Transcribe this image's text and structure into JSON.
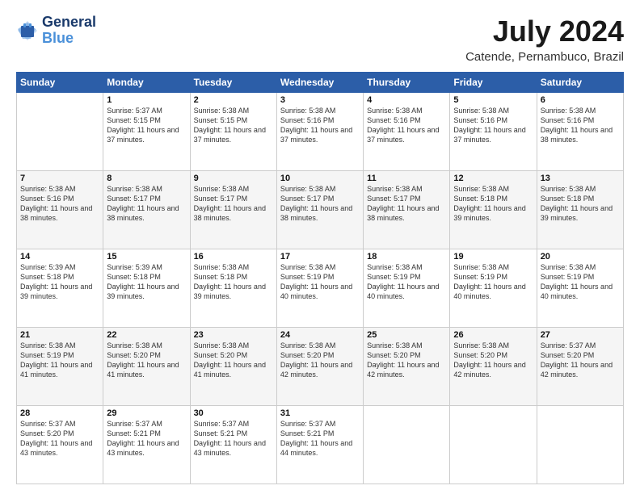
{
  "header": {
    "logo_line1": "General",
    "logo_line2": "Blue",
    "main_title": "July 2024",
    "subtitle": "Catende, Pernambuco, Brazil"
  },
  "calendar": {
    "days_of_week": [
      "Sunday",
      "Monday",
      "Tuesday",
      "Wednesday",
      "Thursday",
      "Friday",
      "Saturday"
    ],
    "weeks": [
      [
        {
          "day": "",
          "sunrise": "",
          "sunset": "",
          "daylight": ""
        },
        {
          "day": "1",
          "sunrise": "Sunrise: 5:37 AM",
          "sunset": "Sunset: 5:15 PM",
          "daylight": "Daylight: 11 hours and 37 minutes."
        },
        {
          "day": "2",
          "sunrise": "Sunrise: 5:38 AM",
          "sunset": "Sunset: 5:15 PM",
          "daylight": "Daylight: 11 hours and 37 minutes."
        },
        {
          "day": "3",
          "sunrise": "Sunrise: 5:38 AM",
          "sunset": "Sunset: 5:16 PM",
          "daylight": "Daylight: 11 hours and 37 minutes."
        },
        {
          "day": "4",
          "sunrise": "Sunrise: 5:38 AM",
          "sunset": "Sunset: 5:16 PM",
          "daylight": "Daylight: 11 hours and 37 minutes."
        },
        {
          "day": "5",
          "sunrise": "Sunrise: 5:38 AM",
          "sunset": "Sunset: 5:16 PM",
          "daylight": "Daylight: 11 hours and 37 minutes."
        },
        {
          "day": "6",
          "sunrise": "Sunrise: 5:38 AM",
          "sunset": "Sunset: 5:16 PM",
          "daylight": "Daylight: 11 hours and 38 minutes."
        }
      ],
      [
        {
          "day": "7",
          "sunrise": "Sunrise: 5:38 AM",
          "sunset": "Sunset: 5:16 PM",
          "daylight": "Daylight: 11 hours and 38 minutes."
        },
        {
          "day": "8",
          "sunrise": "Sunrise: 5:38 AM",
          "sunset": "Sunset: 5:17 PM",
          "daylight": "Daylight: 11 hours and 38 minutes."
        },
        {
          "day": "9",
          "sunrise": "Sunrise: 5:38 AM",
          "sunset": "Sunset: 5:17 PM",
          "daylight": "Daylight: 11 hours and 38 minutes."
        },
        {
          "day": "10",
          "sunrise": "Sunrise: 5:38 AM",
          "sunset": "Sunset: 5:17 PM",
          "daylight": "Daylight: 11 hours and 38 minutes."
        },
        {
          "day": "11",
          "sunrise": "Sunrise: 5:38 AM",
          "sunset": "Sunset: 5:17 PM",
          "daylight": "Daylight: 11 hours and 38 minutes."
        },
        {
          "day": "12",
          "sunrise": "Sunrise: 5:38 AM",
          "sunset": "Sunset: 5:18 PM",
          "daylight": "Daylight: 11 hours and 39 minutes."
        },
        {
          "day": "13",
          "sunrise": "Sunrise: 5:38 AM",
          "sunset": "Sunset: 5:18 PM",
          "daylight": "Daylight: 11 hours and 39 minutes."
        }
      ],
      [
        {
          "day": "14",
          "sunrise": "Sunrise: 5:39 AM",
          "sunset": "Sunset: 5:18 PM",
          "daylight": "Daylight: 11 hours and 39 minutes."
        },
        {
          "day": "15",
          "sunrise": "Sunrise: 5:39 AM",
          "sunset": "Sunset: 5:18 PM",
          "daylight": "Daylight: 11 hours and 39 minutes."
        },
        {
          "day": "16",
          "sunrise": "Sunrise: 5:38 AM",
          "sunset": "Sunset: 5:18 PM",
          "daylight": "Daylight: 11 hours and 39 minutes."
        },
        {
          "day": "17",
          "sunrise": "Sunrise: 5:38 AM",
          "sunset": "Sunset: 5:19 PM",
          "daylight": "Daylight: 11 hours and 40 minutes."
        },
        {
          "day": "18",
          "sunrise": "Sunrise: 5:38 AM",
          "sunset": "Sunset: 5:19 PM",
          "daylight": "Daylight: 11 hours and 40 minutes."
        },
        {
          "day": "19",
          "sunrise": "Sunrise: 5:38 AM",
          "sunset": "Sunset: 5:19 PM",
          "daylight": "Daylight: 11 hours and 40 minutes."
        },
        {
          "day": "20",
          "sunrise": "Sunrise: 5:38 AM",
          "sunset": "Sunset: 5:19 PM",
          "daylight": "Daylight: 11 hours and 40 minutes."
        }
      ],
      [
        {
          "day": "21",
          "sunrise": "Sunrise: 5:38 AM",
          "sunset": "Sunset: 5:19 PM",
          "daylight": "Daylight: 11 hours and 41 minutes."
        },
        {
          "day": "22",
          "sunrise": "Sunrise: 5:38 AM",
          "sunset": "Sunset: 5:20 PM",
          "daylight": "Daylight: 11 hours and 41 minutes."
        },
        {
          "day": "23",
          "sunrise": "Sunrise: 5:38 AM",
          "sunset": "Sunset: 5:20 PM",
          "daylight": "Daylight: 11 hours and 41 minutes."
        },
        {
          "day": "24",
          "sunrise": "Sunrise: 5:38 AM",
          "sunset": "Sunset: 5:20 PM",
          "daylight": "Daylight: 11 hours and 42 minutes."
        },
        {
          "day": "25",
          "sunrise": "Sunrise: 5:38 AM",
          "sunset": "Sunset: 5:20 PM",
          "daylight": "Daylight: 11 hours and 42 minutes."
        },
        {
          "day": "26",
          "sunrise": "Sunrise: 5:38 AM",
          "sunset": "Sunset: 5:20 PM",
          "daylight": "Daylight: 11 hours and 42 minutes."
        },
        {
          "day": "27",
          "sunrise": "Sunrise: 5:37 AM",
          "sunset": "Sunset: 5:20 PM",
          "daylight": "Daylight: 11 hours and 42 minutes."
        }
      ],
      [
        {
          "day": "28",
          "sunrise": "Sunrise: 5:37 AM",
          "sunset": "Sunset: 5:20 PM",
          "daylight": "Daylight: 11 hours and 43 minutes."
        },
        {
          "day": "29",
          "sunrise": "Sunrise: 5:37 AM",
          "sunset": "Sunset: 5:21 PM",
          "daylight": "Daylight: 11 hours and 43 minutes."
        },
        {
          "day": "30",
          "sunrise": "Sunrise: 5:37 AM",
          "sunset": "Sunset: 5:21 PM",
          "daylight": "Daylight: 11 hours and 43 minutes."
        },
        {
          "day": "31",
          "sunrise": "Sunrise: 5:37 AM",
          "sunset": "Sunset: 5:21 PM",
          "daylight": "Daylight: 11 hours and 44 minutes."
        },
        {
          "day": "",
          "sunrise": "",
          "sunset": "",
          "daylight": ""
        },
        {
          "day": "",
          "sunrise": "",
          "sunset": "",
          "daylight": ""
        },
        {
          "day": "",
          "sunrise": "",
          "sunset": "",
          "daylight": ""
        }
      ]
    ]
  }
}
